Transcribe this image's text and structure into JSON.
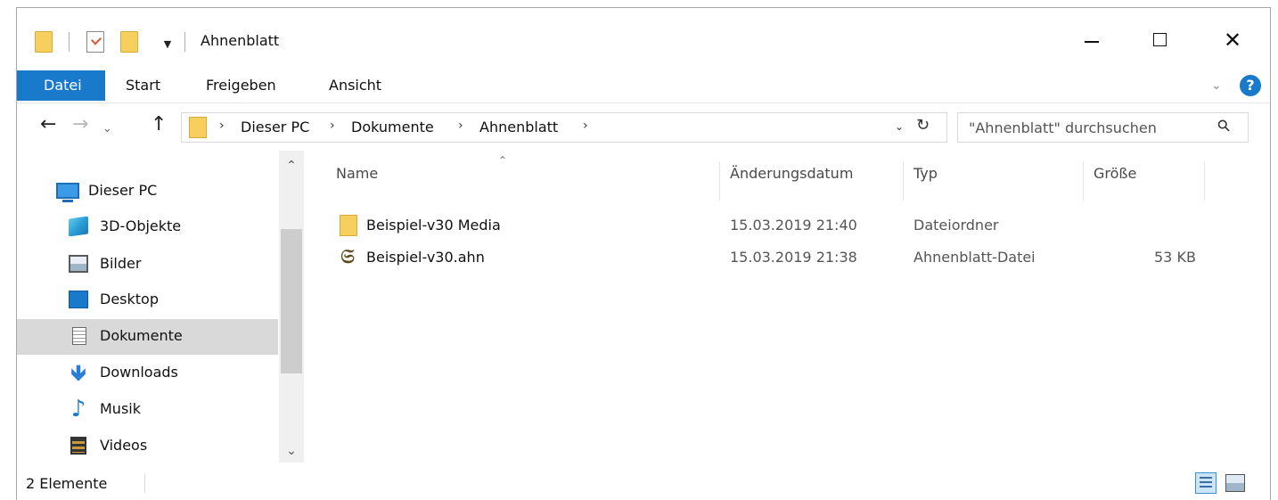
{
  "window": {
    "title": "Ahnenblatt"
  },
  "ribbon": {
    "tabs": [
      "Datei",
      "Start",
      "Freigeben",
      "Ansicht"
    ],
    "active_tab_color": "#1979ca"
  },
  "navigation": {
    "back_icon": "arrow-left-icon",
    "forward_icon": "arrow-right-icon",
    "recent_icon": "chevron-down-icon",
    "up_icon": "arrow-up-icon"
  },
  "address": {
    "breadcrumbs": [
      "Dieser PC",
      "Dokumente",
      "Ahnenblatt"
    ]
  },
  "search": {
    "placeholder": "\"Ahnenblatt\" durchsuchen"
  },
  "sidebar": {
    "items": [
      {
        "label": "Dieser PC",
        "icon": "computer-icon"
      },
      {
        "label": "3D-Objekte",
        "icon": "cube-3d-icon"
      },
      {
        "label": "Bilder",
        "icon": "pictures-icon"
      },
      {
        "label": "Desktop",
        "icon": "desktop-icon"
      },
      {
        "label": "Dokumente",
        "icon": "documents-icon",
        "selected": true
      },
      {
        "label": "Downloads",
        "icon": "downloads-icon"
      },
      {
        "label": "Musik",
        "icon": "music-icon"
      },
      {
        "label": "Videos",
        "icon": "videos-icon"
      }
    ]
  },
  "filelist": {
    "columns": [
      "Name",
      "Änderungsdatum",
      "Typ",
      "Größe"
    ],
    "rows": [
      {
        "name": "Beispiel-v30 Media",
        "date": "15.03.2019 21:40",
        "type": "Dateiordner",
        "size": "",
        "icon": "folder-icon"
      },
      {
        "name": "Beispiel-v30.ahn",
        "date": "15.03.2019 21:38",
        "type": "Ahnenblatt-Datei",
        "size": "53 KB",
        "icon": "ahnenblatt-file-icon"
      }
    ]
  },
  "status": {
    "count": "2 Elemente"
  }
}
